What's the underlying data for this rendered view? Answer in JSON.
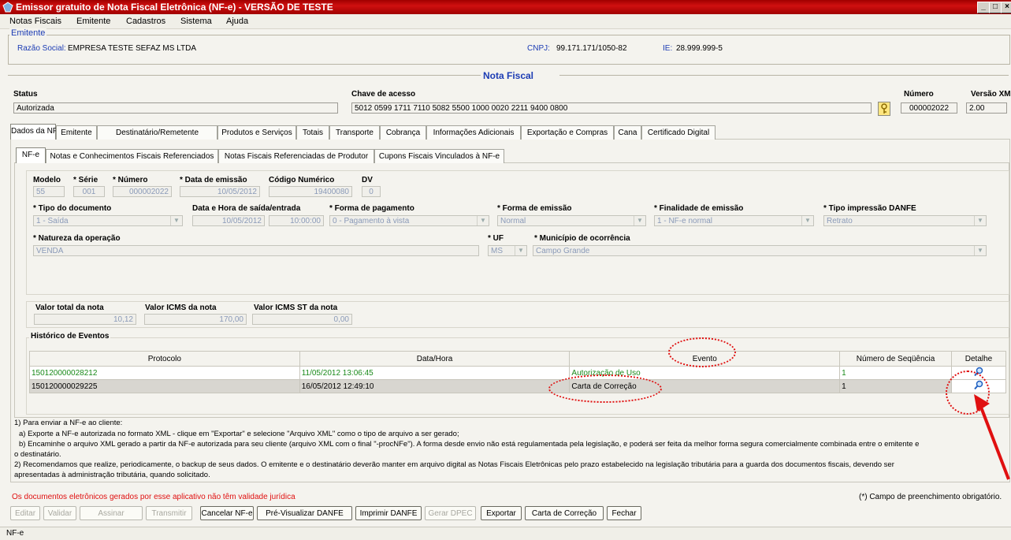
{
  "window": {
    "title": "Emissor gratuito de Nota Fiscal Eletrônica (NF-e) - VERSÃO DE TESTE",
    "controls": [
      "_",
      "□",
      "×"
    ]
  },
  "menu": [
    "Notas Fiscais",
    "Emitente",
    "Cadastros",
    "Sistema",
    "Ajuda"
  ],
  "emitente": {
    "legend": "Emitente",
    "razao_label": "Razão Social:",
    "razao_value": "EMPRESA TESTE SEFAZ MS LTDA",
    "cnpj_label": "CNPJ:",
    "cnpj_value": "99.171.171/1050-82",
    "ie_label": "IE:",
    "ie_value": "28.999.999-5"
  },
  "nota": {
    "heading": "Nota Fiscal",
    "status_label": "Status",
    "status_value": "Autorizada",
    "chave_label": "Chave de acesso",
    "chave_value": "5012 0599 1711 7110 5082 5500 1000 0020 2211 9400 0800",
    "numero_label": "Número",
    "numero_value": "000002022",
    "versao_label": "Versão XML",
    "versao_value": "2.00"
  },
  "tabs": [
    "Dados da NF-e",
    "Emitente",
    "Destinatário/Remetente",
    "Produtos e Serviços",
    "Totais",
    "Transporte",
    "Cobrança",
    "Informações Adicionais",
    "Exportação e Compras",
    "Cana",
    "Certificado Digital"
  ],
  "subtabs": [
    "NF-e",
    "Notas e Conhecimentos Fiscais Referenciados",
    "Notas Fiscais Referenciadas de Produtor",
    "Cupons Fiscais Vinculados à NF-e"
  ],
  "form": {
    "modelo_label": "Modelo",
    "modelo_value": "55",
    "serie_label": "Série",
    "serie_value": "001",
    "numero_label": "Número",
    "numero_value": "000002022",
    "data_emissao_label": "Data de emissão",
    "data_emissao_value": "10/05/2012",
    "codigo_label": "Código Numérico",
    "codigo_value": "19400080",
    "dv_label": "DV",
    "dv_value": "0",
    "tipo_doc_label": "Tipo do documento",
    "tipo_doc_value": "1 - Saída",
    "data_saida_label": "Data e Hora de saída/entrada",
    "data_saida_value": "10/05/2012",
    "hora_saida_value": "10:00:00",
    "forma_pag_label": "Forma de pagamento",
    "forma_pag_value": "0 - Pagamento à vista",
    "forma_emissao_label": "Forma de emissão",
    "forma_emissao_value": "Normal",
    "finalidade_label": "Finalidade de emissão",
    "finalidade_value": "1 - NF-e normal",
    "tipo_danfe_label": "Tipo impressão DANFE",
    "tipo_danfe_value": "Retrato",
    "natureza_label": "Natureza da operação",
    "natureza_value": "VENDA",
    "uf_label": "UF",
    "uf_value": "MS",
    "municipio_label": "Município de ocorrência",
    "municipio_value": "Campo Grande",
    "valor_total_label": "Valor total da nota",
    "valor_total_value": "10,12",
    "valor_icms_label": "Valor ICMS da nota",
    "valor_icms_value": "170,00",
    "valor_icms_st_label": "Valor ICMS ST da nota",
    "valor_icms_st_value": "0,00"
  },
  "historico": {
    "legend": "Histórico de Eventos",
    "columns": [
      "Protocolo",
      "Data/Hora",
      "Evento",
      "Número de Seqüência",
      "Detalhe"
    ],
    "rows": [
      {
        "protocolo": "150120000028212",
        "data": "11/05/2012 13:06:45",
        "evento": "Autorização de Uso",
        "seq": "1"
      },
      {
        "protocolo": "150120000029225",
        "data": "16/05/2012 12:49:10",
        "evento": "Carta de Correção",
        "seq": "1"
      }
    ]
  },
  "notes": [
    "1) Para enviar a NF-e ao cliente:",
    "a) Exporte a NF-e autorizada no formato XML - clique em \"Exportar\" e selecione \"Arquivo XML\" como o tipo de arquivo a ser gerado;",
    "b) Encaminhe o arquivo XML gerado a partir da NF-e autorizada para seu cliente (arquivo XML com o final \"-procNFe\"). A forma desde envio não está regulamentada pela legislação, e poderá ser feita da melhor forma segura comercialmente combinada entre o emitente e",
    "o destinatário.",
    "2) Recomendamos que realize, periodicamente, o backup de seus dados. O emitente e o destinatário deverão manter em arquivo digital as Notas Fiscais Eletrônicas pelo prazo estabelecido na legislação tributária para a guarda dos documentos fiscais, devendo ser",
    "apresentadas à administração tributária, quando solicitado."
  ],
  "warning": "Os documentos eletrônicos gerados por esse aplicativo não têm validade jurídica",
  "required_note": "(*) Campo de preenchimento obrigatório.",
  "buttons": {
    "editar": "Editar",
    "validar": "Validar",
    "assinar": "Assinar",
    "transmitir": "Transmitir",
    "cancelar": "Cancelar NF-e",
    "previsualizar": "Pré-Visualizar DANFE",
    "imprimir": "Imprimir DANFE",
    "dpec": "Gerar DPEC",
    "exportar": "Exportar",
    "carta": "Carta de Correção",
    "fechar": "Fechar"
  },
  "statusbar": "NF-e",
  "colors": {
    "titlebar": "#c00000",
    "accent": "#1c3cb4",
    "warning": "#e01010",
    "event_green": "#1a8a1a"
  }
}
